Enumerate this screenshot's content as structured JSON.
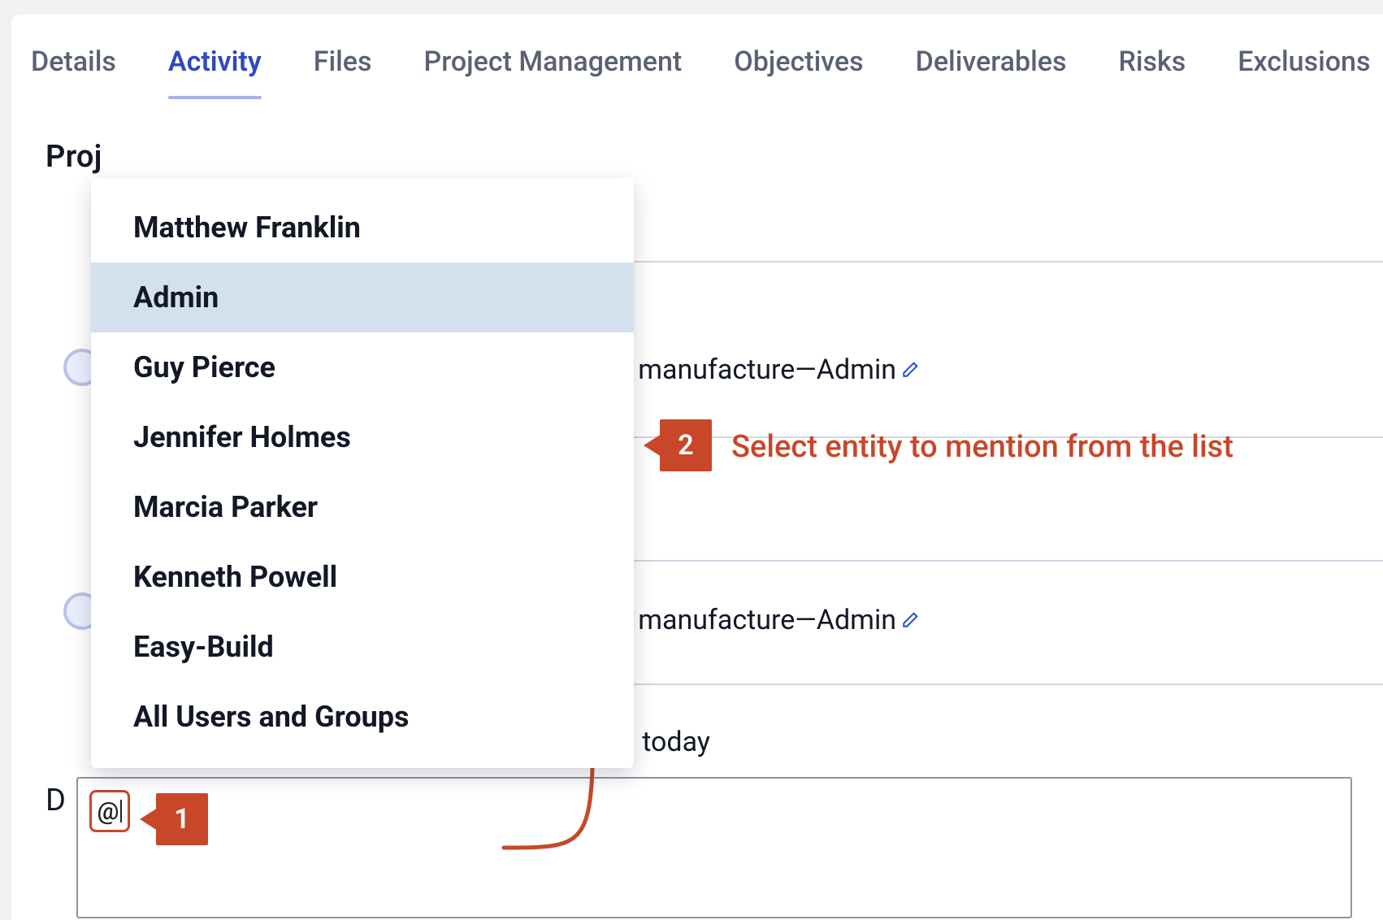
{
  "tabs": [
    "Details",
    "Activity",
    "Files",
    "Project Management",
    "Objectives",
    "Deliverables",
    "Risks",
    "Exclusions"
  ],
  "active_tab_index": 1,
  "section": {
    "title_truncated": "Proj",
    "description_label_truncated": "D"
  },
  "mention": {
    "options": [
      "Matthew Franklin",
      "Admin",
      "Guy Pierce",
      "Jennifer Holmes",
      "Marcia Parker",
      "Kenneth Powell",
      "Easy-Build",
      "All Users and Groups"
    ],
    "highlighted_index": 1
  },
  "feed": [
    {
      "link_fragment": ":il manufacture",
      "dash": " — ",
      "author": "Admin"
    },
    {
      "link_fragment": ":il manufacture",
      "dash": " — ",
      "author": "Admin"
    },
    {
      "text_fragment": "m today"
    }
  ],
  "input": {
    "value": "@"
  },
  "annotations": [
    {
      "number": "1"
    },
    {
      "number": "2",
      "text": "Select entity to mention from the list"
    }
  ],
  "colors": {
    "callout": "#c84729",
    "link": "#1f4bd8",
    "tab_active": "#3048c1",
    "highlight_row": "#d3e0ee"
  }
}
